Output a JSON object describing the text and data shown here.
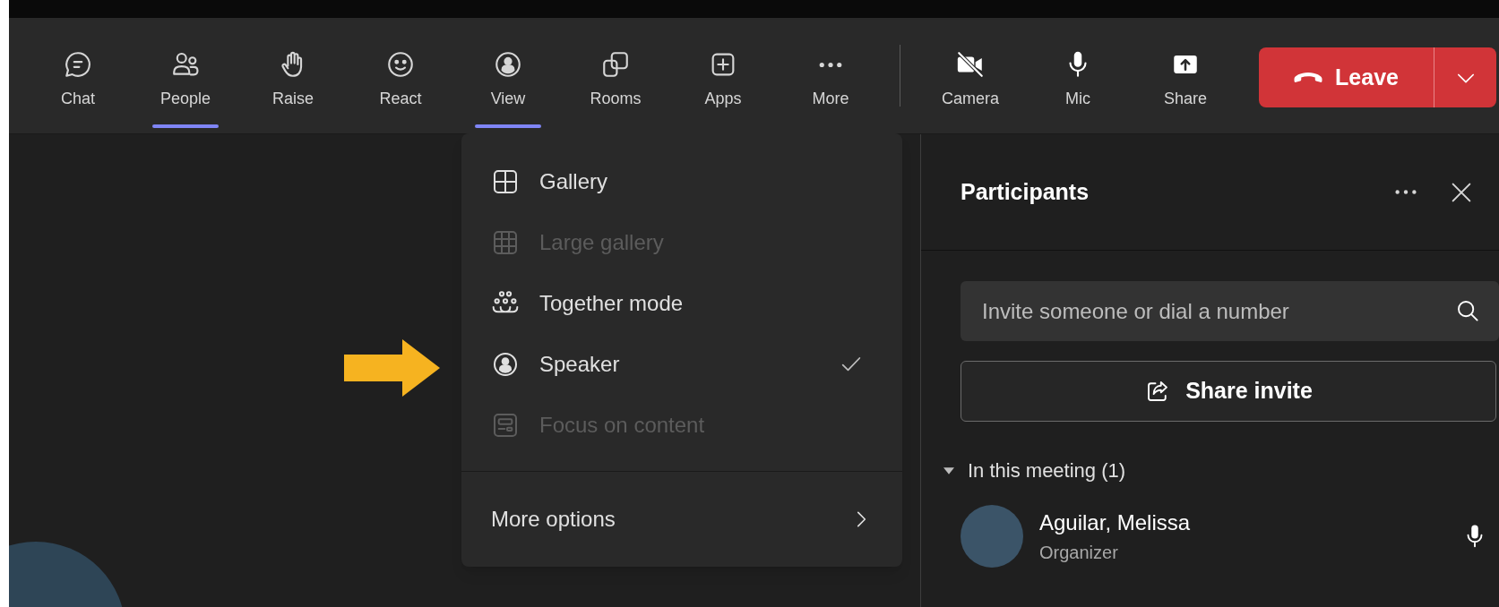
{
  "toolbar": {
    "items": [
      {
        "label": "Chat",
        "selected": false
      },
      {
        "label": "People",
        "selected": true
      },
      {
        "label": "Raise",
        "selected": false
      },
      {
        "label": "React",
        "selected": false
      },
      {
        "label": "View",
        "selected": true
      },
      {
        "label": "Rooms",
        "selected": false
      },
      {
        "label": "Apps",
        "selected": false
      },
      {
        "label": "More",
        "selected": false
      }
    ],
    "media": [
      {
        "label": "Camera"
      },
      {
        "label": "Mic"
      },
      {
        "label": "Share"
      }
    ],
    "leave": {
      "label": "Leave"
    }
  },
  "view_menu": {
    "items": [
      {
        "label": "Gallery",
        "disabled": false,
        "checked": false
      },
      {
        "label": "Large gallery",
        "disabled": true,
        "checked": false
      },
      {
        "label": "Together mode",
        "disabled": false,
        "checked": false
      },
      {
        "label": "Speaker",
        "disabled": false,
        "checked": true
      },
      {
        "label": "Focus on content",
        "disabled": true,
        "checked": false
      }
    ],
    "more": "More options"
  },
  "participants": {
    "title": "Participants",
    "search": {
      "placeholder": "Invite someone or dial a number"
    },
    "share_button": "Share invite",
    "section": {
      "label": "In this meeting (1)",
      "expanded": true
    },
    "people": [
      {
        "name": "Aguilar, Melissa",
        "role": "Organizer"
      }
    ]
  }
}
